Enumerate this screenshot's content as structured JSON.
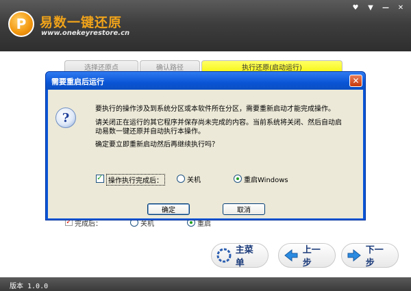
{
  "app": {
    "title": "易数一键还原",
    "url": "www.onekeyrestore.cn",
    "logo_glyph": "P",
    "window_controls": [
      "♥",
      "▼",
      "—",
      "✕"
    ]
  },
  "tabs": [
    {
      "label": "选择还原点"
    },
    {
      "label": "确认路径"
    },
    {
      "label": "执行还原(启动运行)"
    }
  ],
  "behind_options": {
    "after_label": "完成后：",
    "shutdown_label": "关机",
    "restart_label": "重启"
  },
  "actions": {
    "main_menu": "主菜单",
    "prev": "上一步",
    "next": "下一步"
  },
  "footer": {
    "version": "版本 1.0.0"
  },
  "dialog": {
    "title": "需要重启后运行",
    "close": "✕",
    "icon": "question-icon",
    "line1": "要执行的操作涉及到系统分区或本软件所在分区，需要重新启动才能完成操作。",
    "line2a": "请关闭正在运行的其它程序并保存尚未完成的内容。当前系统将关闭、然后自动启",
    "line2b": "动易数一键还原并自动执行本操作。",
    "line3": "确定要立即重新启动然后再继续执行吗？",
    "checkbox_label": "操作执行完成后：",
    "checkbox_checked": true,
    "option_shutdown": "关机",
    "option_restart": "重启Windows",
    "selected_option": "重启Windows",
    "ok": "确定",
    "cancel": "取消"
  },
  "colors": {
    "title_bar": "#0a55d6",
    "brand_orange": "#f0a31a",
    "active_tab": "#ffff33"
  }
}
